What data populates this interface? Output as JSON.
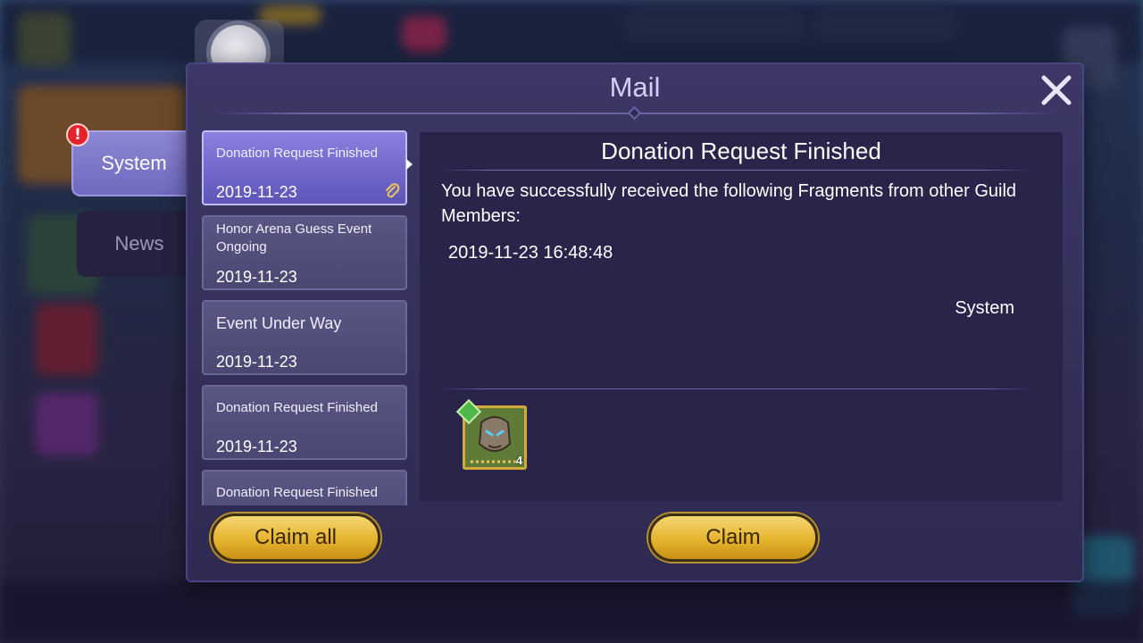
{
  "dialog": {
    "title": "Mail",
    "close_icon": "close-icon"
  },
  "categories": [
    {
      "label": "System",
      "selected": true,
      "alert": "!"
    },
    {
      "label": "News",
      "selected": false
    }
  ],
  "mail_list": [
    {
      "subject": "Donation Request Finished",
      "date": "2019-11-23",
      "selected": true,
      "has_attachment": true
    },
    {
      "subject": "Honor Arena Guess Event Ongoing",
      "date": "2019-11-23",
      "selected": false
    },
    {
      "subject": "Event Under Way",
      "date": "2019-11-23",
      "selected": false
    },
    {
      "subject": "Donation Request Finished",
      "date": "2019-11-23",
      "selected": false
    },
    {
      "subject": "Donation Request Finished",
      "date": "",
      "selected": false
    }
  ],
  "detail": {
    "title": "Donation Request Finished",
    "body": "You have successfully received the following Fragments from other Guild Members:",
    "timestamp": "2019-11-23 16:48:48",
    "sender": "System",
    "reward": {
      "icon": "hero-fragment-icon",
      "count": "4"
    }
  },
  "buttons": {
    "claim_all": "Claim all",
    "claim": "Claim"
  },
  "colors": {
    "accent_gold": "#e6b42e",
    "dialog_bg": "#3c3766",
    "selected_item": "#8a80e0",
    "alert_red": "#e3232c"
  }
}
